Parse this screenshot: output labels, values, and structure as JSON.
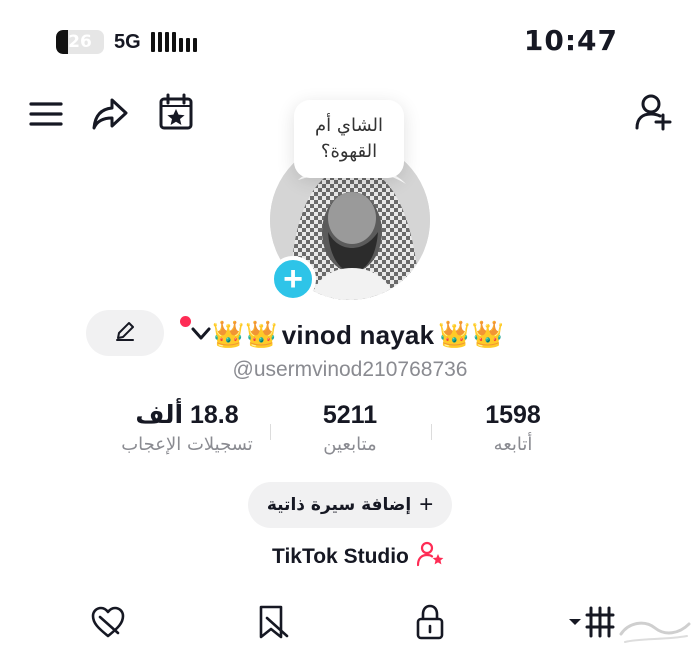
{
  "status_bar": {
    "battery_level": "26",
    "battery_fraction": 0.26,
    "network": "5G",
    "time": "10:47"
  },
  "toolbar": {
    "menu_icon": "hamburger-menu-icon",
    "share_icon": "share-arrow-icon",
    "calendar_icon": "calendar-star-icon",
    "add_friend_icon": "add-person-icon"
  },
  "profile": {
    "bubble_text": "الشاي أم القهوة؟",
    "avatar_add_symbol": "+",
    "crown_glyph": "👑",
    "display_name": "vinod nayak",
    "username": "@usermvinod210768736",
    "edit_icon": "pencil-icon"
  },
  "stats": [
    {
      "value": "1598",
      "label": "أتابعه"
    },
    {
      "value": "5211",
      "label": "متابعين"
    },
    {
      "value": "18.8 ألف",
      "label": "تسجيلات الإعجاب"
    }
  ],
  "bio_button": {
    "label": "إضافة سيرة ذاتية",
    "symbol": "+"
  },
  "studio": {
    "label": "TikTok Studio",
    "icon": "person-star-icon"
  },
  "tabs": [
    {
      "name": "videos-grid",
      "icon": "grid-icon"
    },
    {
      "name": "private",
      "icon": "lock-icon"
    },
    {
      "name": "favorites",
      "icon": "bookmark-icon"
    },
    {
      "name": "liked",
      "icon": "heart-icon"
    }
  ],
  "colors": {
    "accent_red": "#fe2c55",
    "avatar_add_blue": "#2ec4e8",
    "secondary_text": "#8a8b91",
    "pill_bg": "#f1f1f2"
  }
}
